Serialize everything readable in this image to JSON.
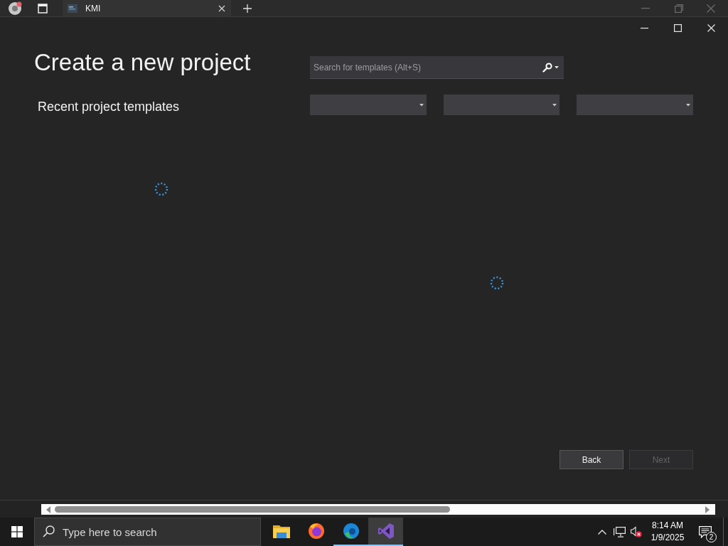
{
  "browser": {
    "tabs": [
      {
        "title": "KMI",
        "selected": true
      }
    ]
  },
  "dialog": {
    "title": "Create a new project",
    "search": {
      "placeholder": "Search for templates (Alt+S)"
    },
    "recent": {
      "heading": "Recent project templates",
      "loading": true
    },
    "templates": {
      "loading": true
    },
    "buttons": [
      {
        "label": "Back",
        "disabled": false
      },
      {
        "label": "Next",
        "disabled": true
      }
    ]
  },
  "taskbar": {
    "search": {
      "placeholder": "Type here to search"
    },
    "apps": [
      {
        "kind": "folder",
        "running": false,
        "selected": false
      },
      {
        "kind": "flame",
        "running": false,
        "selected": false
      },
      {
        "kind": "swirl",
        "running": true,
        "selected": false
      },
      {
        "kind": "loop",
        "running": true,
        "selected": true
      }
    ],
    "tray": {
      "muted": true,
      "time": "8:14 AM",
      "date": "1/9/2025",
      "notifications": "2"
    }
  }
}
